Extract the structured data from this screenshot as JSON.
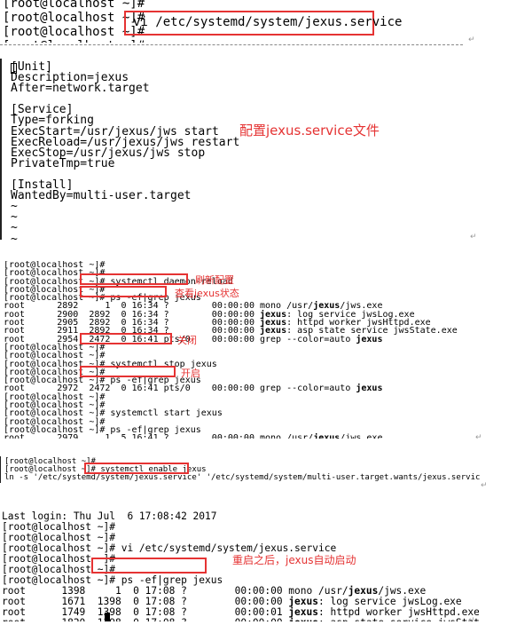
{
  "panel1": {
    "lines": [
      "[root@localhost ~]#",
      "[root@localhost ~]#",
      "[root@localhost ~]#",
      "[root@localhost ~]#"
    ],
    "command": "vi /etc/systemd/system/jexus.service"
  },
  "panel2": {
    "lines": [
      "[Unit]",
      "Description=jexus",
      "After=network.target",
      "",
      "[Service]",
      "Type=forking",
      "ExecStart=/usr/jexus/jws start",
      "ExecReload=/usr/jexus/jws restart",
      "ExecStop=/usr/jexus/jws stop",
      "PrivateTmp=true",
      "",
      "[Install]",
      "WantedBy=multi-user.target",
      "~",
      "~",
      "~",
      "~"
    ],
    "annotation": "配置jexus.service文件"
  },
  "panel3": {
    "lines": [
      "[root@localhost ~]#",
      "[root@localhost ~]#",
      "[root@localhost ~]# systemctl daemon-reload",
      "[root@localhost ~]#",
      "[root@localhost ~]# ps -ef|grep jexus",
      "root      2892     1  0 16:34 ?        00:00:00 mono /usr/jexus/jws.exe",
      "root      2900  2892  0 16:34 ?        00:00:00 jexus: log service jwsLog.exe",
      "root      2905  2892  0 16:34 ?        00:00:00 jexus: httpd worker jwsHttpd.exe",
      "root      2911  2892  0 16:34 ?        00:00:00 jexus: asp state service jwsState.exe",
      "root      2954  2472  0 16:41 pts/0    00:00:00 grep --color=auto jexus",
      "[root@localhost ~]#",
      "[root@localhost ~]#",
      "[root@localhost ~]# systemctl stop jexus",
      "[root@localhost ~]#",
      "[root@localhost ~]# ps -ef|grep jexus",
      "root      2972  2472  0 16:41 pts/0    00:00:00 grep --color=auto jexus",
      "[root@localhost ~]#",
      "[root@localhost ~]#",
      "[root@localhost ~]# systemctl start jexus",
      "[root@localhost ~]#",
      "[root@localhost ~]# ps -ef|grep jexus",
      "root      2979     1  5 16:41 ?        00:00:00 mono /usr/jexus/jws.exe",
      "root      2987  2979  3 16:41 ?        00:00:00 jexus: log service jwsLog.exe",
      "root      2992  2979  6 16:41 ?        00:00:00 jexus: httpd worker jwsHttpd.exe",
      "root      2998  2979  5 16:41 ?        00:00:00 jexus: asp state service jwsState.exe",
      "root      3013  2472  0 16:41 pts/0    00:00:00 grep --color=auto jexus",
      "[root@localhost ~]#",
      "[root@localhost ~]#"
    ],
    "notes": {
      "reload": "刷新配置",
      "status": "查看jexus状态",
      "stop": "关闭",
      "start": "开启"
    }
  },
  "panel4": {
    "lines": [
      "[root@localhost ~]#",
      "[root@localhost ~]# systemctl enable jexus",
      "ln -s '/etc/systemd/system/jexus.service' '/etc/systemd/system/multi-user.target.wants/jexus.service'"
    ]
  },
  "panel5": {
    "lines": [
      "Last login: Thu Jul  6 17:08:42 2017",
      "[root@localhost ~]#",
      "[root@localhost ~]#",
      "[root@localhost ~]# vi /etc/systemd/system/jexus.service",
      "[root@localhost ~]#",
      "[root@localhost ~]#",
      "[root@localhost ~]# ps -ef|grep jexus",
      "root      1398     1  0 17:08 ?        00:00:00 mono /usr/jexus/jws.exe",
      "root      1671  1398  0 17:08 ?        00:00:00 jexus: log service jwsLog.exe",
      "root      1749  1398  0 17:08 ?        00:00:01 jexus: httpd worker jwsHttpd.exe",
      "root      1820  1398  0 17:08 ?        00:00:00 jexus: asp state service jwsState.exe",
      "root      2559  2519  0 17:28 pts/0    00:00:00 grep --color=auto jexus",
      "[root@localhost ~]#"
    ],
    "annotation": "重启之后，jexus自动启动"
  },
  "colors": {
    "annotation": "#e53333",
    "highlight_box": "#e53333",
    "text": "#000000"
  },
  "icons": {
    "paragraph_mark": "return-arrow-icon"
  }
}
